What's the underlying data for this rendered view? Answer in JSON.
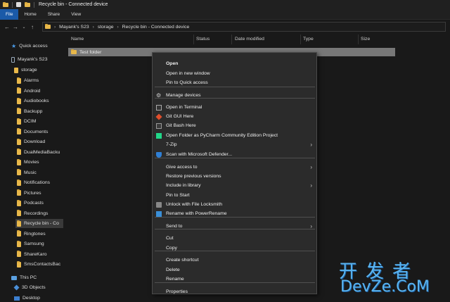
{
  "window": {
    "title": "Recycle bin - Connected device"
  },
  "ribbon": {
    "tabs": [
      "File",
      "Home",
      "Share",
      "View"
    ]
  },
  "address": {
    "crumbs": [
      "Mayank's S23",
      "storage",
      "Recycle bin - Connected device"
    ]
  },
  "columns": [
    "Name",
    "Status",
    "Date modified",
    "Type",
    "Size"
  ],
  "sidebar": {
    "quick_access": "Quick access",
    "device": "Mayank's S23",
    "storage": "storage",
    "folders": [
      "Alarms",
      "Android",
      "Audiobooks",
      "Backupp",
      "DCIM",
      "Documents",
      "Download",
      "DualMediaBacku",
      "Movies",
      "Music",
      "Notifications",
      "Pictures",
      "Podcasts",
      "Recordings",
      "Recycle bin - Co",
      "Ringtones",
      "Samsung",
      "ShareKaro",
      "SmsContactsBac"
    ],
    "this_pc": "This PC",
    "objects_3d": "3D Objects",
    "desktop": "Desktop"
  },
  "files": [
    {
      "name": "Test folder"
    }
  ],
  "context_menu": {
    "items": [
      {
        "label": "Open",
        "bold": true
      },
      {
        "label": "Open in new window"
      },
      {
        "label": "Pin to Quick access"
      },
      {
        "label": "Manage devices",
        "icon": "gear-icon"
      },
      {
        "label": "Open in Terminal",
        "icon": "terminal-icon"
      },
      {
        "label": "Git GUI Here",
        "icon": "git-icon"
      },
      {
        "label": "Git Bash Here",
        "icon": "git-bash-icon"
      },
      {
        "label": "Open Folder as PyCharm Community Edition Project",
        "icon": "pycharm-icon"
      },
      {
        "label": "7-Zip",
        "submenu": true
      },
      {
        "label": "Scan with Microsoft Defender...",
        "icon": "defender-shield-icon"
      },
      {
        "label": "Give access to",
        "submenu": true
      },
      {
        "label": "Restore previous versions"
      },
      {
        "label": "Include in library",
        "submenu": true
      },
      {
        "label": "Pin to Start"
      },
      {
        "label": "Unlock with File Locksmith",
        "icon": "lock-icon"
      },
      {
        "label": "Rename with PowerRename",
        "icon": "powerrename-icon"
      },
      {
        "label": "Send to",
        "submenu": true
      },
      {
        "label": "Cut"
      },
      {
        "label": "Copy"
      },
      {
        "label": "Create shortcut"
      },
      {
        "label": "Delete"
      },
      {
        "label": "Rename"
      },
      {
        "label": "Properties"
      }
    ]
  },
  "watermark": {
    "cn": "开发者",
    "en": "DevZe.CoM"
  },
  "colors": {
    "accent": "#1a5aa8",
    "folder": "#e8b84a",
    "selected_row": "#777777",
    "menu_bg": "#2b2b2b"
  }
}
